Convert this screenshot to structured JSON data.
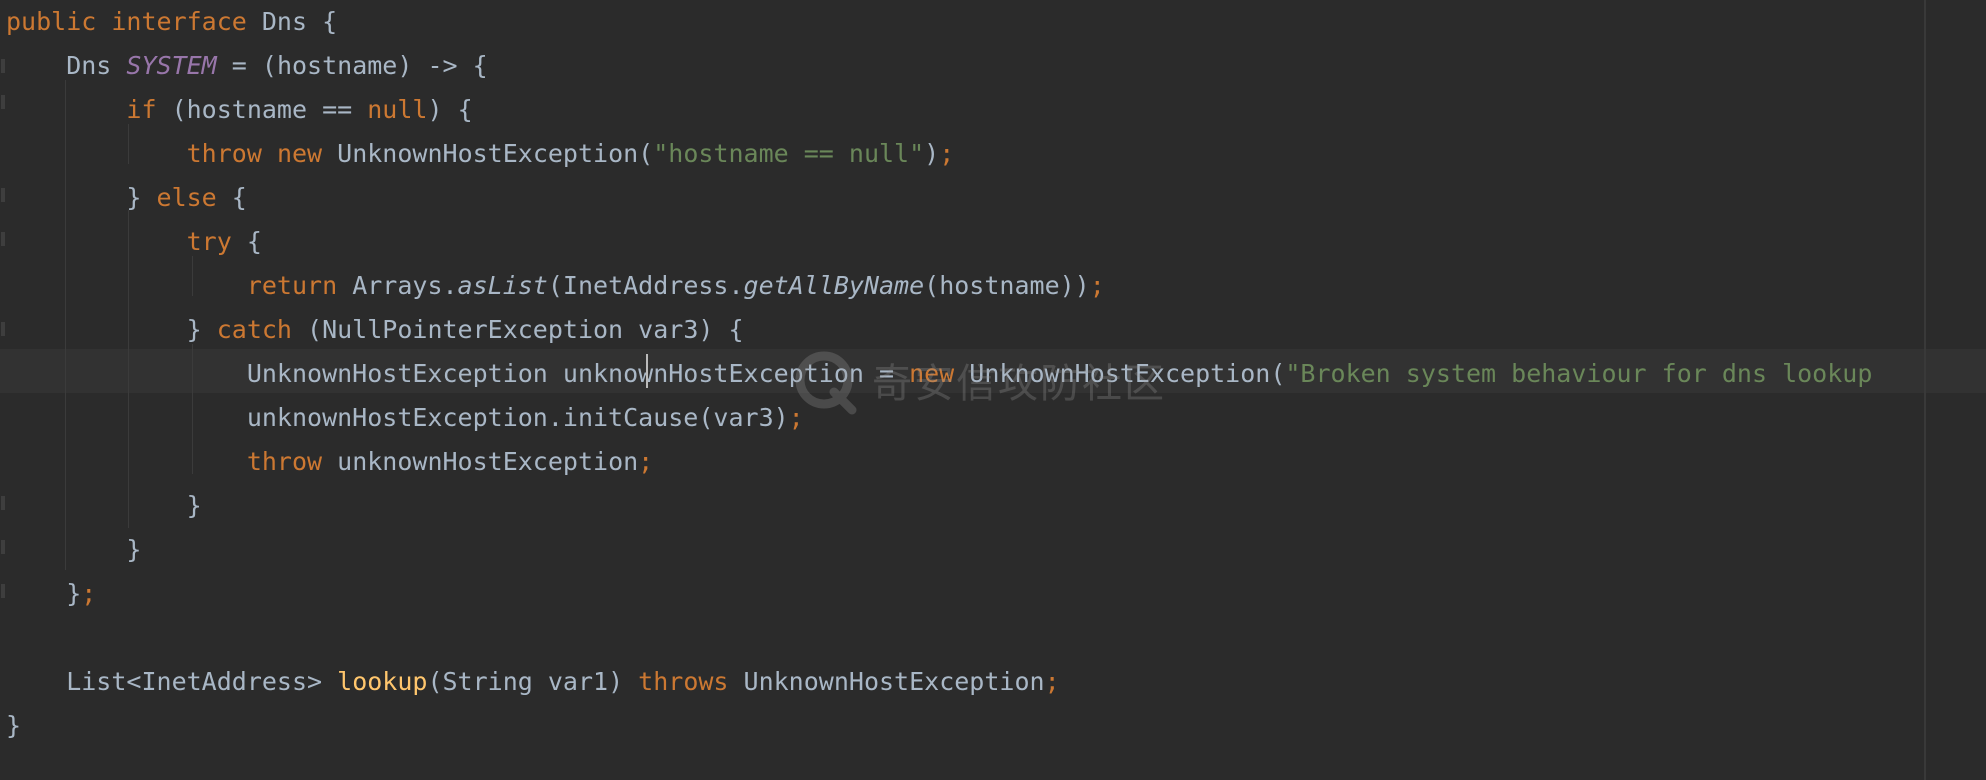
{
  "editor": {
    "language": "java",
    "caret_line": 9,
    "lines": [
      [
        [
          "kw",
          "public "
        ],
        [
          "kw",
          "interface "
        ],
        [
          "",
          "Dns {"
        ]
      ],
      [
        [
          "",
          "    Dns "
        ],
        [
          "fld",
          "SYSTEM"
        ],
        [
          "",
          " = (hostname) -> {"
        ]
      ],
      [
        [
          "kw",
          "        if "
        ],
        [
          "",
          "(hostname == "
        ],
        [
          "kw",
          "null"
        ],
        [
          "",
          ") {"
        ]
      ],
      [
        [
          "kw",
          "            throw "
        ],
        [
          "kw",
          "new "
        ],
        [
          "",
          "UnknownHostException("
        ],
        [
          "str",
          "\"hostname == null\""
        ],
        [
          "",
          ")"
        ],
        [
          "kw",
          ";"
        ]
      ],
      [
        [
          "",
          "        } "
        ],
        [
          "kw",
          "else "
        ],
        [
          "",
          "{"
        ]
      ],
      [
        [
          "kw",
          "            try "
        ],
        [
          "",
          "{"
        ]
      ],
      [
        [
          "kw",
          "                return "
        ],
        [
          "",
          "Arrays."
        ],
        [
          "sm",
          "asList"
        ],
        [
          "",
          "(InetAddress."
        ],
        [
          "sm",
          "getAllByName"
        ],
        [
          "",
          "(hostname))"
        ],
        [
          "kw",
          ";"
        ]
      ],
      [
        [
          "",
          "            } "
        ],
        [
          "kw",
          "catch "
        ],
        [
          "",
          "(NullPointerException var3) {"
        ]
      ],
      [
        [
          "",
          "                UnknownHostException unknownHostException = "
        ],
        [
          "kw",
          "new "
        ],
        [
          "",
          "UnknownHostException("
        ],
        [
          "str",
          "\"Broken system behaviour for dns lookup"
        ]
      ],
      [
        [
          "",
          "                unknownHostException.initCause(var3)"
        ],
        [
          "kw",
          ";"
        ]
      ],
      [
        [
          "kw",
          "                throw "
        ],
        [
          "",
          "unknownHostException"
        ],
        [
          "kw",
          ";"
        ]
      ],
      [
        [
          "",
          "            }"
        ]
      ],
      [
        [
          "",
          "        }"
        ]
      ],
      [
        [
          "",
          "    }"
        ],
        [
          "kw",
          ";"
        ]
      ],
      [],
      [
        [
          "",
          "    List<InetAddress> "
        ],
        [
          "fn",
          "lookup"
        ],
        [
          "",
          "(String var1) "
        ],
        [
          "kw",
          "throws "
        ],
        [
          "",
          "UnknownHostException"
        ],
        [
          "kw",
          ";"
        ]
      ],
      [
        [
          "",
          "}"
        ]
      ]
    ]
  },
  "watermark": {
    "text": "奇安信攻防社区",
    "icon": "qianxin-logo-icon"
  },
  "colors": {
    "background": "#2b2b2b",
    "current_line": "#323232",
    "keyword": "#cc7832",
    "identifier": "#a9b7c6",
    "string": "#6a8759",
    "static_field": "#9876aa",
    "method_declaration": "#ffc66d"
  }
}
